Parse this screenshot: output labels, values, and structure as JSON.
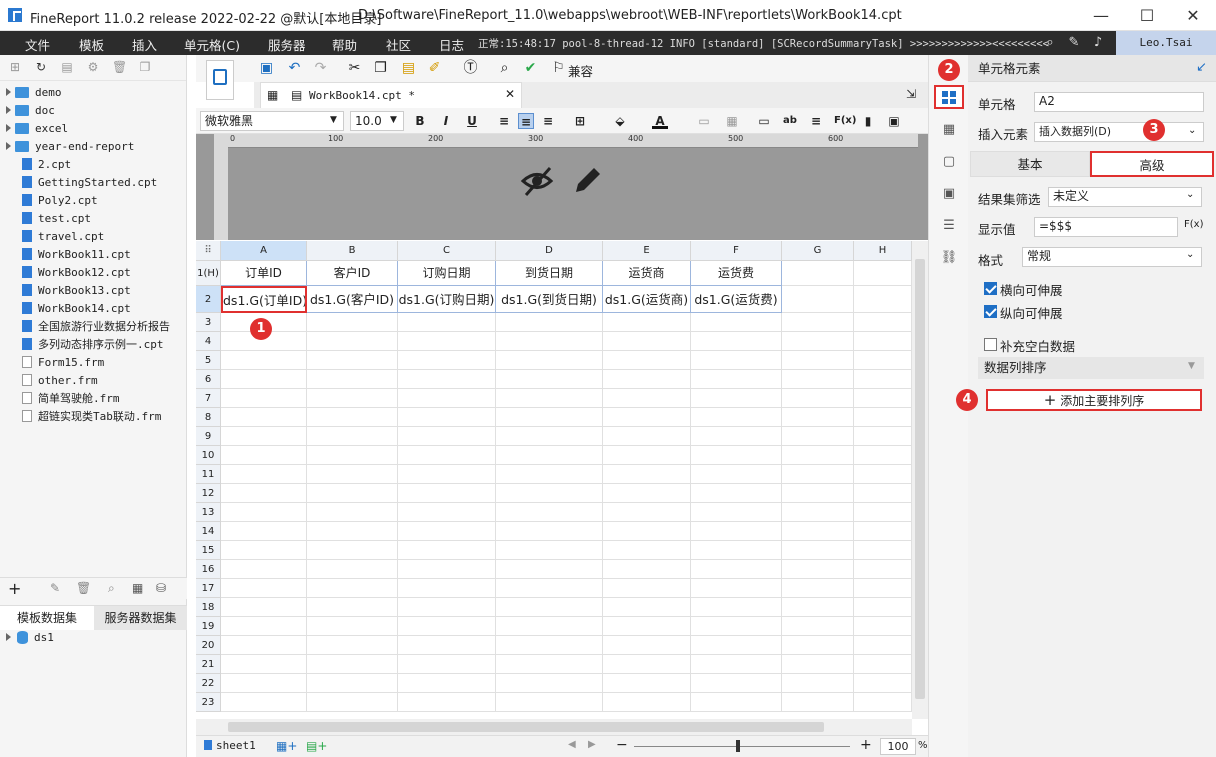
{
  "titlebar": {
    "app_title": "FineReport 11.0.2 release 2022-02-22 @默认[本地目录]",
    "path": "D:\\Software\\FineReport_11.0\\webapps\\webroot\\WEB-INF\\reportlets\\WorkBook14.cpt"
  },
  "menu": {
    "items": [
      "文件",
      "模板",
      "插入",
      "单元格(C)",
      "服务器",
      "帮助",
      "社区"
    ],
    "log_label": "日志",
    "log_text": "正常:15:48:17 pool-8-thread-12 INFO [standard] [SCRecordSummaryTask] >>>>>>>>>>>>><<<<<<<<<",
    "user": "Leo.Tsai"
  },
  "tree": {
    "folders": [
      "demo",
      "doc",
      "excel",
      "year-end-report"
    ],
    "files": [
      "2.cpt",
      "GettingStarted.cpt",
      "Poly2.cpt",
      "test.cpt",
      "travel.cpt",
      "WorkBook11.cpt",
      "WorkBook12.cpt",
      "WorkBook13.cpt",
      "WorkBook14.cpt",
      "全国旅游行业数据分析报告",
      "多列动态排序示例一.cpt",
      "Form15.frm",
      "other.frm",
      "简单驾驶舱.frm",
      "超链实现类Tab联动.frm"
    ]
  },
  "datasets": {
    "tab_template": "模板数据集",
    "tab_server": "服务器数据集",
    "items": [
      "ds1"
    ]
  },
  "toolbar": {
    "compat_label": "兼容",
    "doc_tab": "WorkBook14.cpt *"
  },
  "format": {
    "font": "微软雅黑",
    "size": "10.0",
    "bold": "B",
    "italic": "I",
    "underline": "U"
  },
  "ruler": {
    "ticks": [
      "0",
      "100",
      "200",
      "300",
      "400",
      "500",
      "600"
    ]
  },
  "grid": {
    "columns": [
      "A",
      "B",
      "C",
      "D",
      "E",
      "F",
      "G",
      "H"
    ],
    "row1_label": "1(H)",
    "header_row": [
      "订单ID",
      "客户ID",
      "订购日期",
      "到货日期",
      "运货商",
      "运货费"
    ],
    "data_row": [
      "ds1.G(订单ID)",
      "ds1.G(客户ID)",
      "ds1.G(订购日期)",
      "ds1.G(到货日期)",
      "ds1.G(运货商)",
      "ds1.G(运货费)"
    ],
    "row_numbers": [
      "2",
      "3",
      "4",
      "5",
      "6",
      "7",
      "8",
      "9",
      "10",
      "11",
      "12",
      "13",
      "14",
      "15",
      "16",
      "17",
      "18",
      "19",
      "20",
      "21",
      "22",
      "23"
    ]
  },
  "status": {
    "sheet": "sheet1",
    "zoom": "100",
    "zoom_unit": "%"
  },
  "panel": {
    "title": "单元格元素",
    "cell_label": "单元格",
    "cell_value": "A2",
    "insert_label": "插入元素",
    "insert_value": "插入数据列(D)",
    "tab_basic": "基本",
    "tab_advanced": "高级",
    "filter_label": "结果集筛选",
    "filter_value": "未定义",
    "display_label": "显示值",
    "display_value": "=$$$",
    "format_label": "格式",
    "format_value": "常规",
    "chk_horizontal": "横向可伸展",
    "chk_vertical": "纵向可伸展",
    "chk_fill": "补充空白数据",
    "sort_header": "数据列排序",
    "add_sort_button": "添加主要排列序"
  },
  "badges": [
    "1",
    "2",
    "3",
    "4"
  ],
  "colors": {
    "accent": "#1f6fc5",
    "highlight": "#e0302f",
    "menubar": "#2c2c2c"
  }
}
